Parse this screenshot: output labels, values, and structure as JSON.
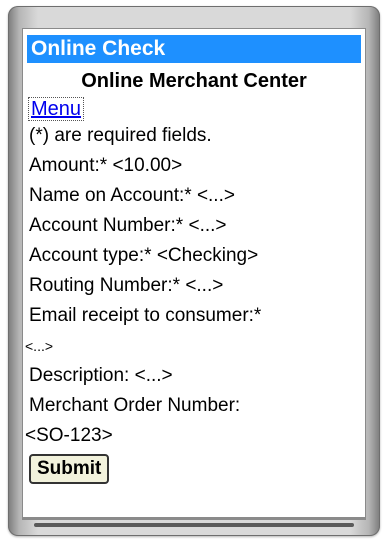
{
  "app": {
    "title": "Online Check"
  },
  "page": {
    "heading": "Online Merchant Center",
    "menu_link": "Menu",
    "required_note": "(*) are required fields."
  },
  "fields": [
    {
      "label": "Amount:*",
      "value": "<10.00>"
    },
    {
      "label": "Name on Account:*",
      "value": "<...>"
    },
    {
      "label": "Account Number:*",
      "value": "<...>"
    },
    {
      "label": "Account type:*",
      "value": "<Checking>"
    },
    {
      "label": "Routing Number:*",
      "value": "<...>"
    },
    {
      "label": "Email receipt to consumer:*",
      "value": "<...>"
    },
    {
      "label": "Description:",
      "value": "<...>"
    },
    {
      "label": "Merchant Order Number:",
      "value": "<SO-123>"
    }
  ],
  "actions": {
    "submit_label": "Submit"
  },
  "colors": {
    "title_bar": "#1e90ff",
    "link": "#0000ee",
    "submit_bg": "#f2f2dc"
  }
}
